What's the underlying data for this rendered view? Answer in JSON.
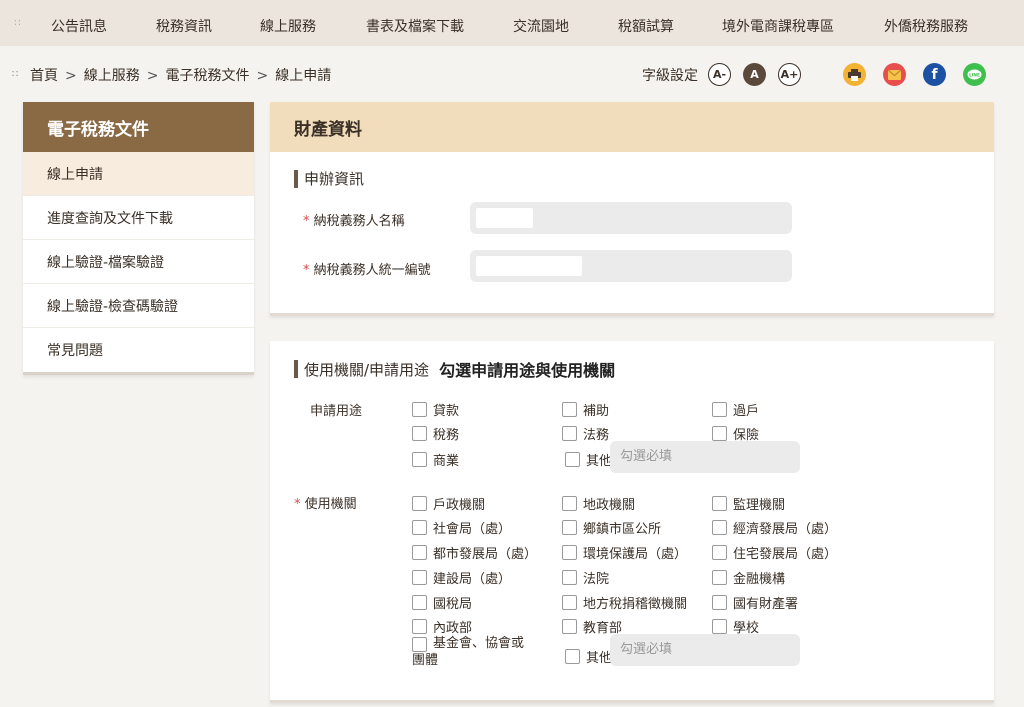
{
  "topnav": {
    "items": [
      "公告訊息",
      "稅務資訊",
      "線上服務",
      "書表及檔案下載",
      "交流園地",
      "稅額試算",
      "境外電商課稅專區",
      "外僑稅務服務"
    ]
  },
  "breadcrumb": [
    "首頁",
    "線上服務",
    "電子稅務文件",
    "線上申請"
  ],
  "fontsize": {
    "label": "字級設定",
    "buttons": [
      "A-",
      "A",
      "A+"
    ]
  },
  "share_icons": [
    "print-icon",
    "mail-icon",
    "facebook-icon",
    "line-icon"
  ],
  "colors": {
    "accent_brown": "#8a6a45",
    "title_tan": "#f1dcbb",
    "active_bg": "#f7ecdd",
    "required_red": "#d94a4a"
  },
  "sidebar": {
    "title": "電子稅務文件",
    "items": [
      "線上申請",
      "進度查詢及文件下載",
      "線上驗證-檔案驗證",
      "線上驗證-檢查碼驗證",
      "常見問題"
    ],
    "active_index": 0
  },
  "property": {
    "title": "財產資料",
    "section": "申辦資訊",
    "taxpayer_name_label": "納稅義務人名稱",
    "taxpayer_id_label": "納稅義務人統一編號",
    "required_mark": "*"
  },
  "usage": {
    "section": "使用機關/申請用途",
    "hint": "勾選申請用途與使用機關",
    "purpose_label": "申請用途",
    "purposes": [
      "貸款",
      "補助",
      "過戶",
      "稅務",
      "法務",
      "保險",
      "商業",
      "其他"
    ],
    "purpose_other_placeholder": "勾選必填",
    "agency_label": "使用機關",
    "agencies": [
      "戶政機關",
      "地政機關",
      "監理機關",
      "社會局（處）",
      "鄉鎮市區公所",
      "經濟發展局（處）",
      "都市發展局（處）",
      "環境保護局（處）",
      "住宅發展局（處）",
      "建設局（處）",
      "法院",
      "金融機構",
      "國稅局",
      "地方稅捐稽徵機關",
      "國有財產署",
      "內政部",
      "教育部",
      "學校",
      "基金會、協會或團體",
      "其他"
    ],
    "agency_other_placeholder": "勾選必填",
    "required_mark": "*"
  }
}
